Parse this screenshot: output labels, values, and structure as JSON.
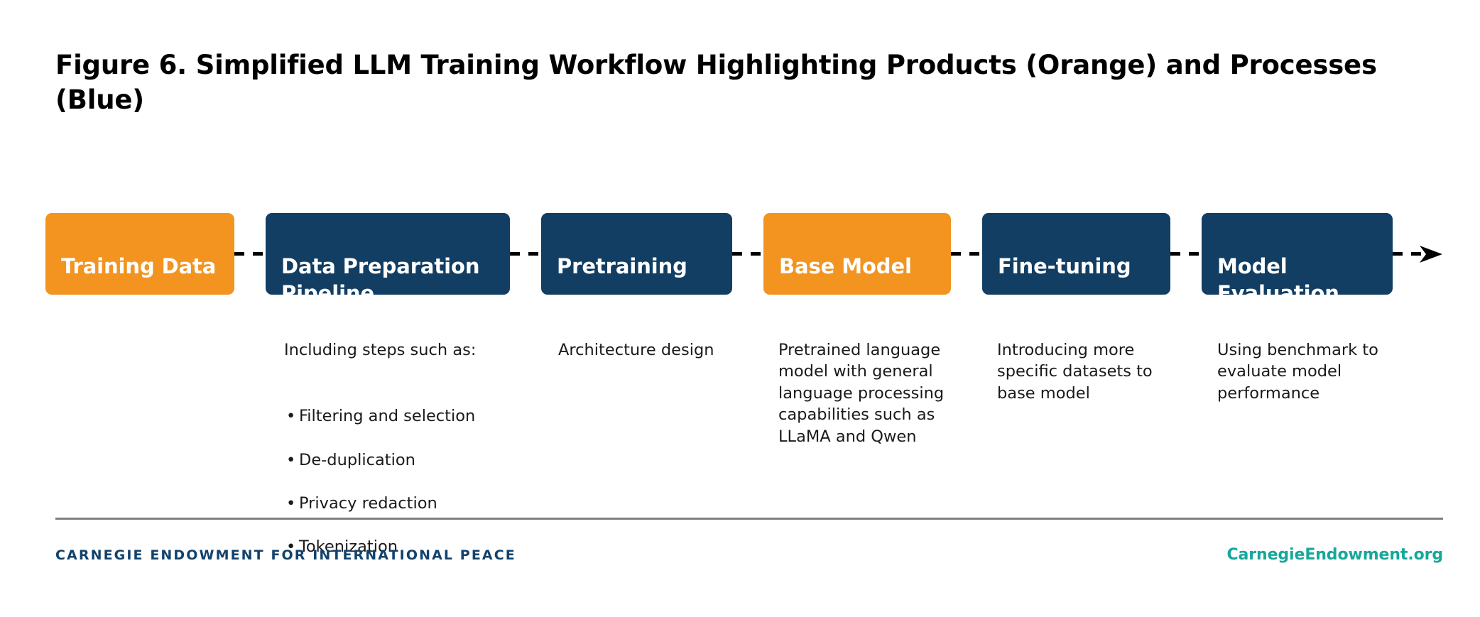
{
  "title": "Figure 6. Simplified LLM Training Workflow Highlighting Products (Orange) and Processes (Blue)",
  "colors": {
    "product": "#F2941F",
    "process": "#123E63",
    "footer_org": "#12426C",
    "footer_site": "#16A79B",
    "divider": "#7F7F7F"
  },
  "legend": {
    "product_label": "Products (Orange)",
    "process_label": "Processes (Blue)"
  },
  "flow": {
    "nodes": [
      {
        "label": "Training Data",
        "kind": "product",
        "caption_intro": "",
        "caption_bullets": []
      },
      {
        "label": "Data Preparation Pipeline",
        "kind": "process",
        "caption_intro": "Including steps such as:",
        "caption_bullets": [
          "Filtering and selection",
          "De-duplication",
          "Privacy redaction",
          "Tokenization"
        ]
      },
      {
        "label": "Pretraining",
        "kind": "process",
        "caption_intro": "Architecture design",
        "caption_bullets": []
      },
      {
        "label": "Base Model",
        "kind": "product",
        "caption_intro": "Pretrained language model with general language processing capabilities such as LLaMA and Qwen",
        "caption_bullets": []
      },
      {
        "label": "Fine-tuning",
        "kind": "process",
        "caption_intro": "Introducing more specific datasets to base model",
        "caption_bullets": []
      },
      {
        "label": "Model Evaluation",
        "kind": "process",
        "caption_intro": "Using benchmark to evaluate model performance",
        "caption_bullets": []
      }
    ],
    "arrow_direction": "right",
    "connector_style": "dashed"
  },
  "footer": {
    "organization": "CARNEGIE ENDOWMENT FOR INTERNATIONAL PEACE",
    "website": "CarnegieEndowment.org"
  }
}
